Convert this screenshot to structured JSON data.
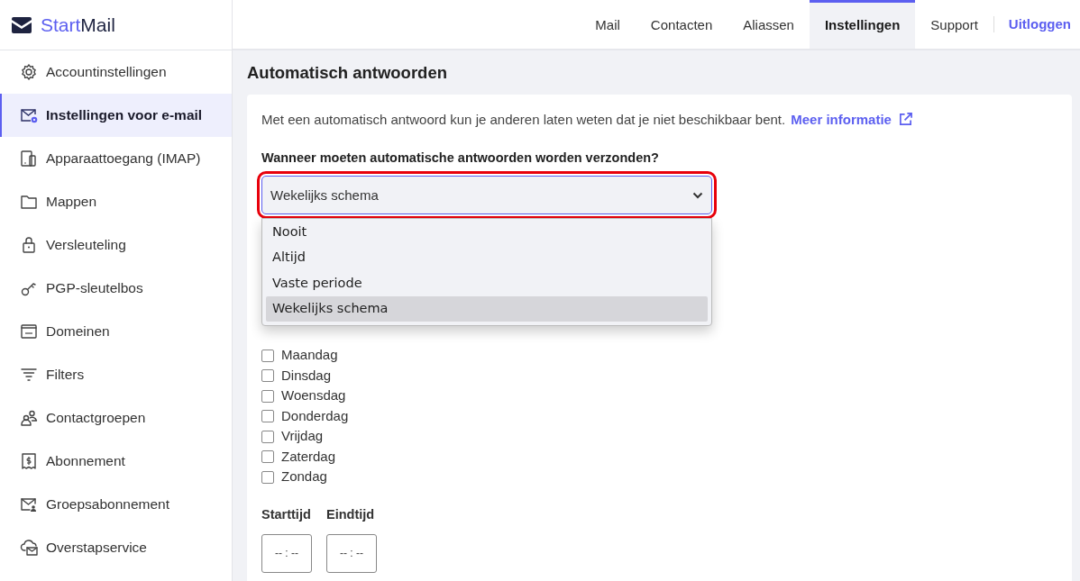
{
  "logo": {
    "part1": "Start",
    "part2": "Mail"
  },
  "sidebar": {
    "items": [
      {
        "label": "Accountinstellingen",
        "selected": false
      },
      {
        "label": "Instellingen voor e-mail",
        "selected": true
      },
      {
        "label": "Apparaattoegang (IMAP)",
        "selected": false
      },
      {
        "label": "Mappen",
        "selected": false
      },
      {
        "label": "Versleuteling",
        "selected": false
      },
      {
        "label": "PGP-sleutelbos",
        "selected": false
      },
      {
        "label": "Domeinen",
        "selected": false
      },
      {
        "label": "Filters",
        "selected": false
      },
      {
        "label": "Contactgroepen",
        "selected": false
      },
      {
        "label": "Abonnement",
        "selected": false
      },
      {
        "label": "Groepsabonnement",
        "selected": false
      },
      {
        "label": "Overstapservice",
        "selected": false
      }
    ]
  },
  "top_nav": {
    "tabs": [
      {
        "label": "Mail",
        "selected": false
      },
      {
        "label": "Contacten",
        "selected": false
      },
      {
        "label": "Aliassen",
        "selected": false
      },
      {
        "label": "Instellingen",
        "selected": true
      },
      {
        "label": "Support",
        "selected": false
      }
    ],
    "logout": "Uitloggen"
  },
  "page_title": "Automatisch antwoorden",
  "intro": "Met een automatisch antwoord kun je anderen laten weten dat je niet beschikbaar bent.",
  "more_info_link": "Meer informatie",
  "question": "Wanneer moeten automatische antwoorden worden verzonden?",
  "schedule_select": {
    "value": "Wekelijks schema",
    "highlighted": true,
    "expanded": true,
    "options": [
      {
        "label": "Nooit",
        "selected": false
      },
      {
        "label": "Altijd",
        "selected": false
      },
      {
        "label": "Vaste periode",
        "selected": false
      },
      {
        "label": "Wekelijks schema",
        "selected": true
      }
    ]
  },
  "days": [
    {
      "label": "Maandag",
      "checked": false
    },
    {
      "label": "Dinsdag",
      "checked": false
    },
    {
      "label": "Woensdag",
      "checked": false
    },
    {
      "label": "Donderdag",
      "checked": false
    },
    {
      "label": "Vrijdag",
      "checked": false
    },
    {
      "label": "Zaterdag",
      "checked": false
    },
    {
      "label": "Zondag",
      "checked": false
    }
  ],
  "times": [
    {
      "label": "Starttijd",
      "placeholder": "-- : --"
    },
    {
      "label": "Eindtijd",
      "placeholder": "-- : --"
    }
  ]
}
